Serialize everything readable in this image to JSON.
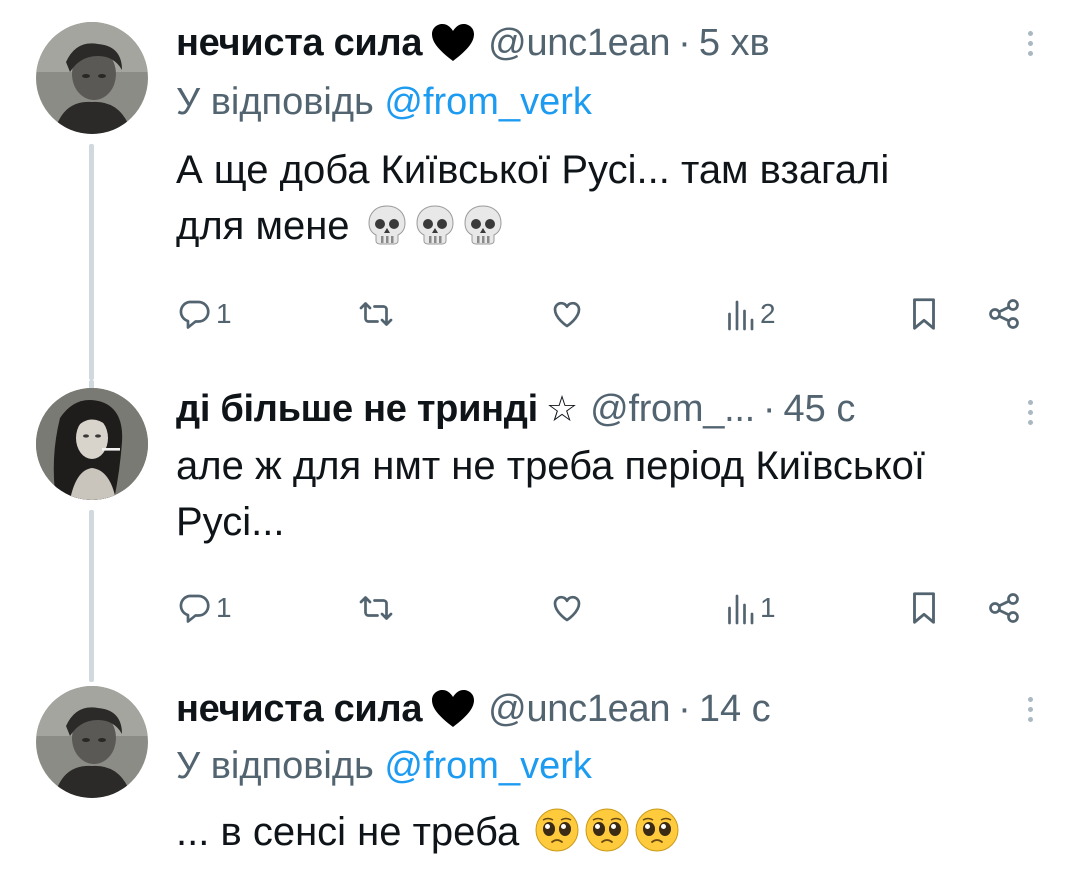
{
  "tweets": [
    {
      "name": "нечиста сила",
      "name_symbol": "black-heart-icon",
      "handle": "@unc1ean",
      "separator": "·",
      "time": "5 хв",
      "reply_prefix": "У відповідь",
      "reply_to": "@from_verk",
      "text": "А ще доба Київської Русі... там взагалі\nдля мене ",
      "emojis": [
        "skull-icon",
        "skull-icon",
        "skull-icon"
      ],
      "replies": "1",
      "views": "2"
    },
    {
      "name": "ді більше не триндi",
      "name_symbol": "☆",
      "handle": "@from_...",
      "separator": "·",
      "time": "45 с",
      "text": "але ж для нмт не треба період Київської\nРусі...",
      "replies": "1",
      "views": "1"
    },
    {
      "name": "нечиста сила",
      "name_symbol": "black-heart-icon",
      "handle": "@unc1ean",
      "separator": "·",
      "time": "14 с",
      "reply_prefix": "У відповідь",
      "reply_to": "@from_verk",
      "text": "... в сенсі не треба ",
      "emojis": [
        "pleading-face-icon",
        "pleading-face-icon",
        "pleading-face-icon"
      ]
    }
  ],
  "colors": {
    "text": "#0f1419",
    "secondary": "#536471",
    "link": "#1d9bf0",
    "thread_line": "#cfd9de"
  }
}
